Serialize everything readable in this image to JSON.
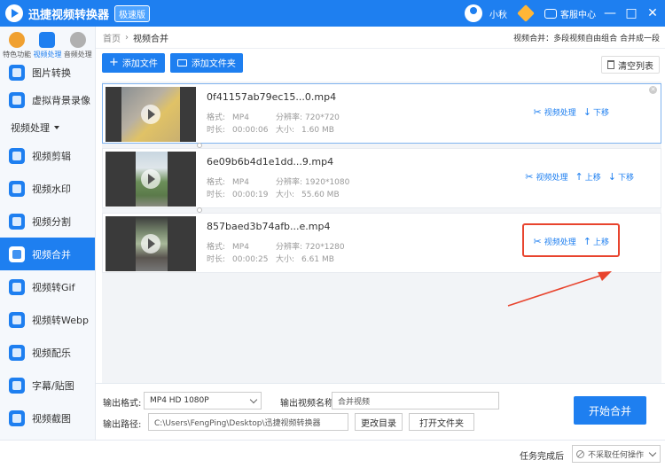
{
  "app": {
    "title": "迅捷视频转换器",
    "badge": "极速版",
    "username": "小秋",
    "service_label": "客服中心",
    "win_min": "—",
    "win_max": "□",
    "win_close": "✕"
  },
  "sidebar": {
    "top_tabs": [
      {
        "label": "特色功能",
        "color": "#f0a030"
      },
      {
        "label": "视频处理",
        "color": "#1e7ff0"
      },
      {
        "label": "音频处理",
        "color": "#b0b0b0"
      }
    ],
    "items_before": [
      {
        "label": "图片转换"
      },
      {
        "label": "虚拟背景录像"
      }
    ],
    "section_label": "视频处理",
    "items": [
      {
        "label": "视频剪辑"
      },
      {
        "label": "视频水印"
      },
      {
        "label": "视频分割"
      },
      {
        "label": "视频合并"
      },
      {
        "label": "视频转Gif"
      },
      {
        "label": "视频转Webp"
      },
      {
        "label": "视频配乐"
      },
      {
        "label": "字幕/贴图"
      },
      {
        "label": "视频截图"
      }
    ]
  },
  "breadcrumb": {
    "home": "首页",
    "sep": "›",
    "current": "视频合并"
  },
  "page_tip": "视频合并：多段视频自由组合 合并成一段",
  "toolbar": {
    "add_file": "添加文件",
    "add_folder": "添加文件夹",
    "clear_list": "清空列表",
    "plus": "+"
  },
  "files": [
    {
      "name": "0f41157ab79ec15...0.mp4",
      "format_label": "格式:",
      "format": "MP4",
      "res_label": "分辨率:",
      "resolution": "720*720",
      "dur_label": "时长:",
      "duration": "00:00:06",
      "size_label": "大小:",
      "size": "1.60 MB",
      "process": "视频处理",
      "move_up": "",
      "move_down": "下移"
    },
    {
      "name": "6e09b6b4d1e1dd...9.mp4",
      "format_label": "格式:",
      "format": "MP4",
      "res_label": "分辨率:",
      "resolution": "1920*1080",
      "dur_label": "时长:",
      "duration": "00:00:19",
      "size_label": "大小:",
      "size": "55.60 MB",
      "process": "视频处理",
      "move_up": "上移",
      "move_down": "下移"
    },
    {
      "name": "857baed3b74afb...e.mp4",
      "format_label": "格式:",
      "format": "MP4",
      "res_label": "分辨率:",
      "resolution": "720*1280",
      "dur_label": "时长:",
      "duration": "00:00:25",
      "size_label": "大小:",
      "size": "6.61 MB",
      "process": "视频处理",
      "move_up": "上移",
      "move_down": ""
    }
  ],
  "settings": {
    "format_label": "输出格式:",
    "format_value": "MP4   HD 1080P",
    "name_label": "输出视频名称",
    "name_value": "合并视频",
    "path_label": "输出路径:",
    "path_value": "C:\\Users\\FengPing\\Desktop\\迅捷视频转换器",
    "change_dir": "更改目录",
    "open_folder": "打开文件夹",
    "start": "开始合并"
  },
  "footer": {
    "after_label": "任务完成后",
    "after_value": "不采取任何操作"
  },
  "colors": {
    "brand": "#1e7ff0",
    "highlight": "#e8442e"
  }
}
